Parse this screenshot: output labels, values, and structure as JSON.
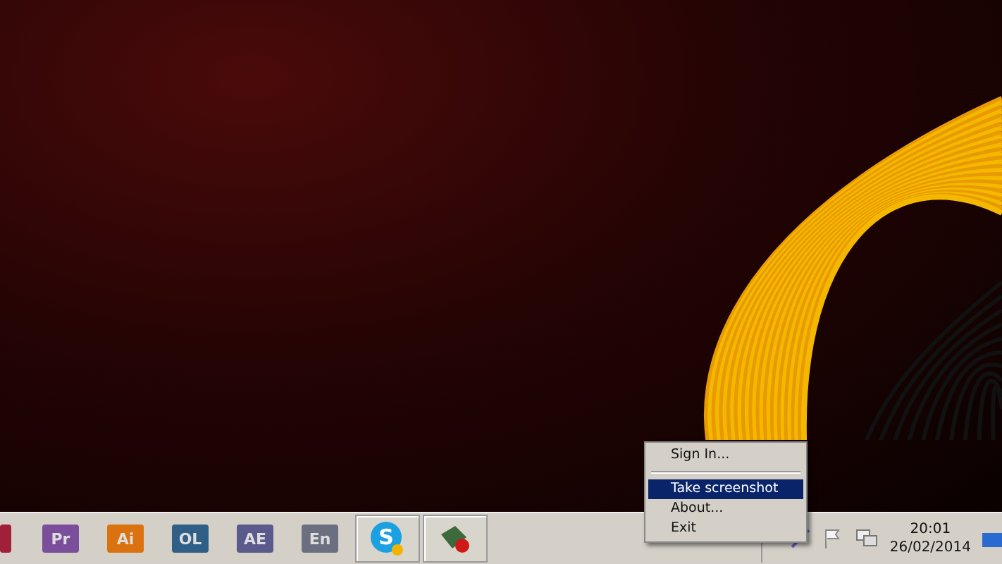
{
  "taskbar": {
    "apps": [
      {
        "kind": "tile",
        "color": "#a0203a"
      },
      {
        "kind": "tile",
        "label": "Pr",
        "color": "#7b4e9c"
      },
      {
        "kind": "tile",
        "label": "Ai",
        "color": "#d9720f"
      },
      {
        "kind": "tile",
        "label": "OL",
        "color": "#2f5f86"
      },
      {
        "kind": "tile",
        "label": "AE",
        "color": "#5a5a8c"
      },
      {
        "kind": "tile",
        "label": "En",
        "color": "#6a7080"
      },
      {
        "kind": "skype",
        "label": "S",
        "color": "#1ba1e2"
      },
      {
        "kind": "recycle",
        "color": "#3c6a3c"
      }
    ]
  },
  "context_menu": {
    "items": [
      {
        "kind": "item",
        "label": "Sign In...",
        "selected": false
      },
      {
        "kind": "separator"
      },
      {
        "kind": "item",
        "label": "Take screenshot",
        "selected": true
      },
      {
        "kind": "item",
        "label": "About...",
        "selected": false
      },
      {
        "kind": "item",
        "label": "Exit",
        "selected": false
      }
    ]
  },
  "clock": {
    "time": "20:01",
    "date": "26/02/2014"
  }
}
